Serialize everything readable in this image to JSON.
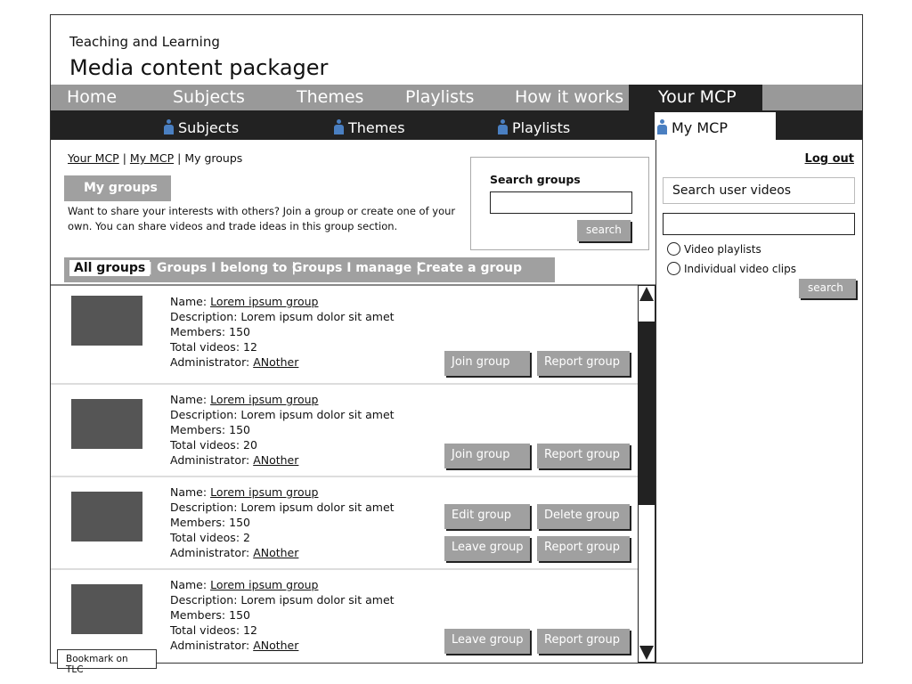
{
  "header": {
    "subtitle": "Teaching and Learning",
    "title": "Media content packager"
  },
  "nav": [
    "Home",
    "Subjects",
    "Themes",
    "Playlists",
    "How it works",
    "Your MCP"
  ],
  "subnav": [
    "Subjects",
    "Themes",
    "Playlists",
    "My MCP"
  ],
  "breadcrumb": {
    "a": "Your MCP",
    "sep": "|",
    "b": "My MCP",
    "c": "My groups"
  },
  "heading": "My groups",
  "intro": "Want to share your interests with others? Join a group or create one of your own. You can share videos and trade ideas in this group section.",
  "search_groups": {
    "label": "Search groups",
    "value": "",
    "button": "search"
  },
  "tabs": [
    "All groups",
    "| Groups I belong to |",
    "Groups I manage |",
    "Create a group"
  ],
  "groups": [
    {
      "name_label": "Name:",
      "name": "Lorem ipsum group",
      "description": "Description: Lorem ipsum dolor sit amet",
      "members": "Members: 150",
      "videos": "Total videos: 12",
      "admin_label": "Administrator:",
      "admin": "ANother",
      "buttons": [
        "Join group",
        "Report group"
      ]
    },
    {
      "name_label": "Name:",
      "name": "Lorem ipsum group",
      "description": "Description: Lorem ipsum dolor sit amet",
      "members": "Members: 150",
      "videos": "Total videos: 20",
      "admin_label": "Administrator:",
      "admin": "ANother",
      "buttons": [
        "Join group",
        "Report group"
      ]
    },
    {
      "name_label": "Name:",
      "name": "Lorem ipsum group",
      "description": "Description: Lorem ipsum dolor sit amet",
      "members": "Members: 150",
      "videos": "Total videos: 2",
      "admin_label": "Administrator:",
      "admin": "ANother",
      "buttons": [
        "Edit group",
        "Delete group",
        "Leave group",
        "Report group"
      ]
    },
    {
      "name_label": "Name:",
      "name": "Lorem ipsum group",
      "description": "Description: Lorem ipsum dolor sit amet",
      "members": "Members: 150",
      "videos": "Total videos: 12",
      "admin_label": "Administrator:",
      "admin": "ANother",
      "buttons": [
        "Leave group",
        "Report group"
      ]
    }
  ],
  "sidebar": {
    "logout": "Log out",
    "search_title": "Search user videos",
    "value": "",
    "options": [
      "Video playlists",
      "Individual video clips"
    ],
    "button": "search"
  },
  "bookmark": "Bookmark on TLC"
}
